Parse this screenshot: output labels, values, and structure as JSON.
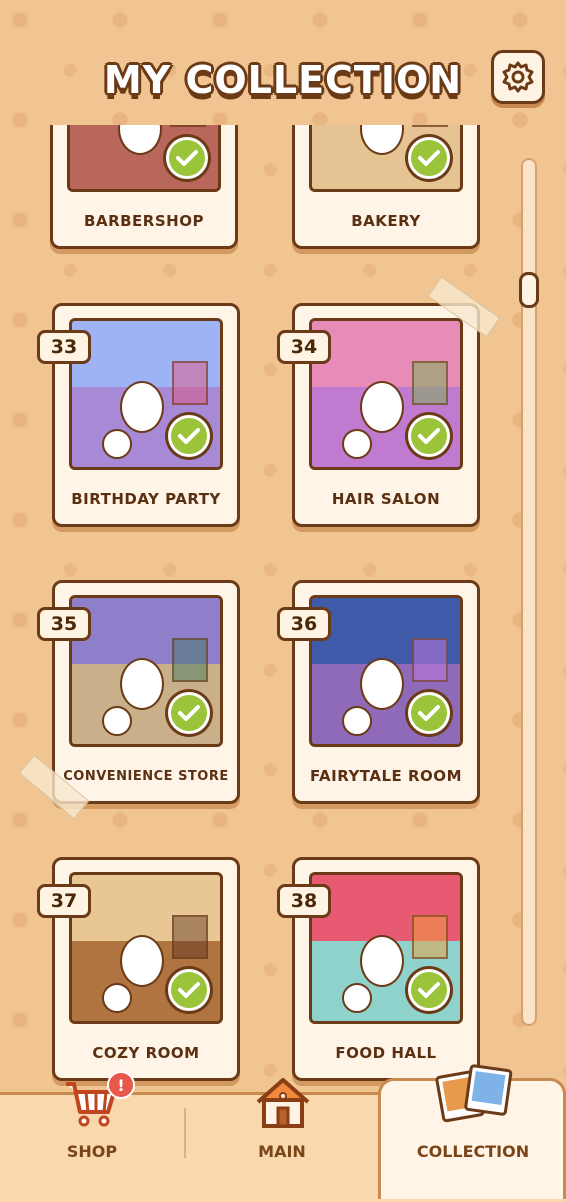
{
  "header": {
    "title": "MY COLLECTION",
    "settings_icon": "gear-icon"
  },
  "collection": [
    {
      "number": "",
      "name": "BARBERSHOP",
      "completed": true
    },
    {
      "number": "",
      "name": "BAKERY",
      "completed": true
    },
    {
      "number": "33",
      "name": "BIRTHDAY PARTY",
      "completed": true
    },
    {
      "number": "34",
      "name": "HAIR SALON",
      "completed": true
    },
    {
      "number": "35",
      "name": "CONVENIENCE STORE",
      "completed": true
    },
    {
      "number": "36",
      "name": "FAIRYTALE ROOM",
      "completed": true
    },
    {
      "number": "37",
      "name": "COZY ROOM",
      "completed": true
    },
    {
      "number": "38",
      "name": "FOOD HALL",
      "completed": true
    }
  ],
  "nav": {
    "shop": {
      "label": "SHOP",
      "icon": "cart-icon",
      "badge": "!"
    },
    "main": {
      "label": "MAIN",
      "icon": "house-icon"
    },
    "collection": {
      "label": "COLLECTION",
      "icon": "photos-icon",
      "active": true
    }
  },
  "colors": {
    "background": "#f1c592",
    "outline": "#6b3a17",
    "check": "#9cc43a",
    "card": "#fff4e8",
    "badge": "#e7584a"
  }
}
